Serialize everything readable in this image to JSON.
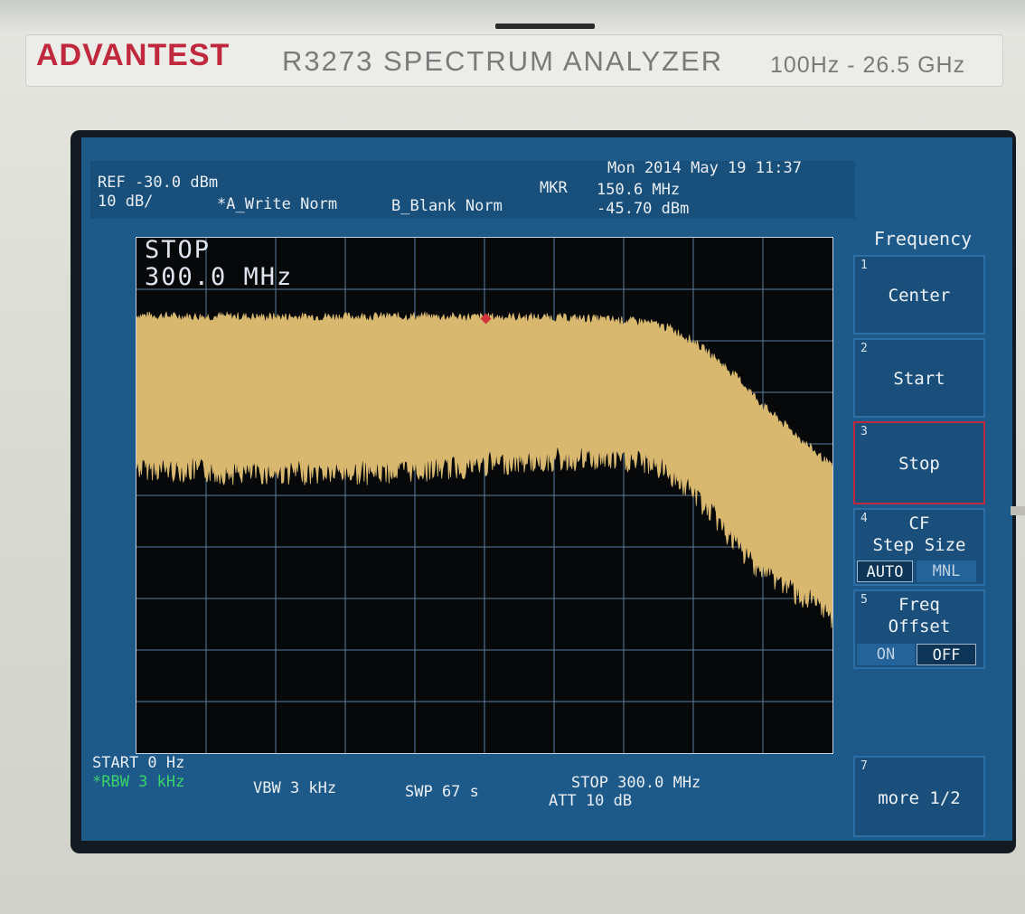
{
  "brand": "ADVANTEST",
  "model": "R3273  SPECTRUM  ANALYZER",
  "range": "100Hz - 26.5 GHz",
  "header": {
    "datetime": "Mon 2014 May 19 11:37",
    "ref": "REF -30.0 dBm",
    "scale": "10 dB/",
    "trace_a": "*A_Write Norm",
    "trace_b": "B_Blank Norm",
    "mkr_label": "MKR",
    "mkr_freq": "150.6 MHz",
    "mkr_level": "-45.70 dBm"
  },
  "overlay": {
    "line1": "STOP",
    "line2": "300.0  MHz"
  },
  "footer": {
    "start": "START 0 Hz",
    "rbw": "*RBW 3 kHz",
    "vbw": "VBW 3 kHz",
    "swp": "SWP 67 s",
    "stop": "STOP 300.0 MHz",
    "att": "ATT 10 dB"
  },
  "softkeys": {
    "title": "Frequency",
    "items": [
      {
        "num": "1",
        "label": "Center"
      },
      {
        "num": "2",
        "label": "Start"
      },
      {
        "num": "3",
        "label": "Stop"
      },
      {
        "num": "4",
        "label_line1": "CF",
        "label_line2": "Step Size",
        "opt_on": "AUTO",
        "opt_off": "MNL"
      },
      {
        "num": "5",
        "label_line1": "Freq",
        "label_line2": "Offset",
        "opt_on": "ON",
        "opt_off": "OFF"
      },
      {
        "num": "7",
        "label": "more 1/2"
      }
    ]
  },
  "colors": {
    "trace": "#d8b86e",
    "screen": "#1d5a8a",
    "brand": "#c0283d",
    "marker": "#d2343a"
  },
  "chart_data": {
    "type": "area",
    "x_unit": "MHz",
    "y_unit": "dBm",
    "xlim": [
      0,
      300
    ],
    "ylim": [
      -130,
      -30
    ],
    "grid": true,
    "marker": {
      "x": 150.6,
      "y": -45.7
    },
    "series": [
      {
        "x": [
          0,
          20,
          40,
          60,
          80,
          100,
          120,
          140,
          160,
          180,
          200,
          220,
          230,
          240,
          250,
          260,
          270,
          280,
          290,
          300
        ],
        "upper": [
          -45.5,
          -45.7,
          -45.7,
          -45.8,
          -45.7,
          -45.7,
          -45.7,
          -45.8,
          -45.8,
          -45.9,
          -46.2,
          -46.8,
          -48,
          -50.5,
          -54,
          -58,
          -63,
          -67,
          -71,
          -75
        ],
        "lower": [
          -72,
          -72.5,
          -73,
          -73,
          -73,
          -73,
          -72.5,
          -72,
          -71,
          -70.5,
          -70.5,
          -71,
          -73,
          -77,
          -82,
          -88,
          -92,
          -95,
          -98,
          -101
        ]
      }
    ]
  }
}
